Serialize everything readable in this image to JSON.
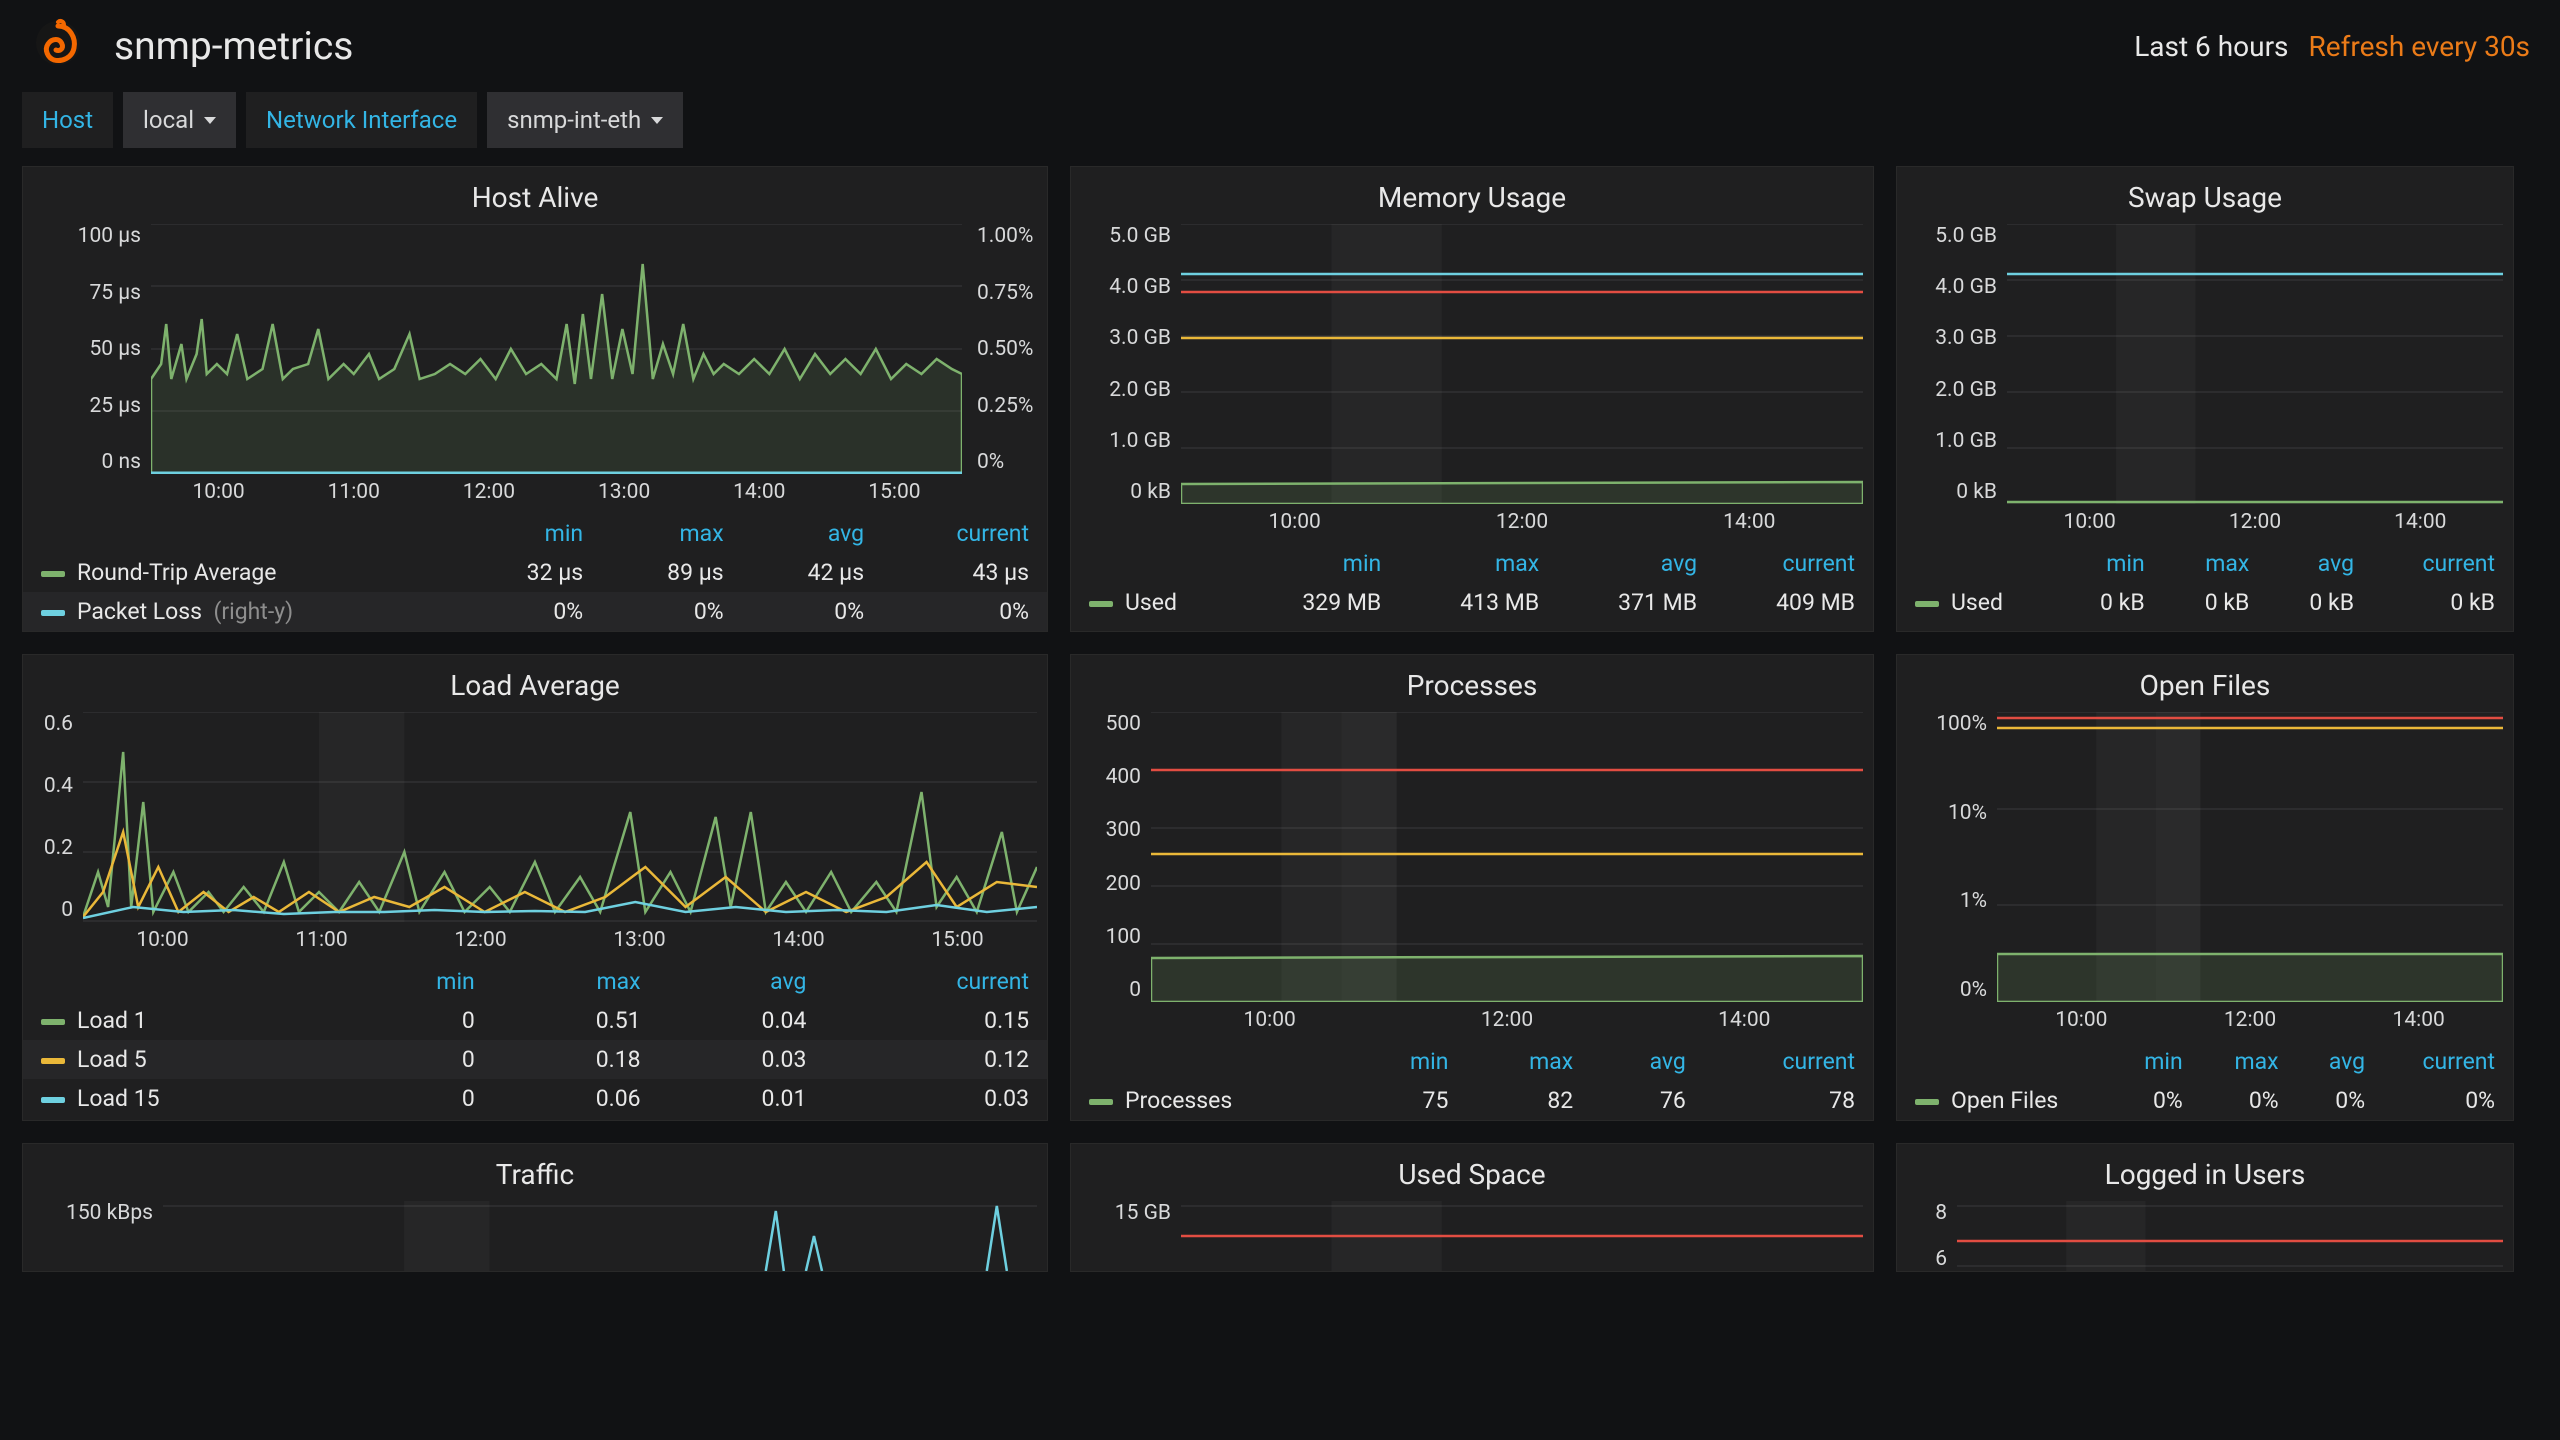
{
  "header": {
    "title": "snmp-metrics",
    "time_range": "Last 6 hours",
    "refresh": "Refresh every 30s"
  },
  "vars": {
    "host_label": "Host",
    "host_value": "local",
    "iface_label": "Network Interface",
    "iface_value": "snmp-int-eth"
  },
  "stat_headers": {
    "min": "min",
    "max": "max",
    "avg": "avg",
    "current": "current"
  },
  "panels": {
    "host_alive": {
      "title": "Host Alive",
      "y_left": [
        "100 µs",
        "75 µs",
        "50 µs",
        "25 µs",
        "0 ns"
      ],
      "y_right": [
        "1.00%",
        "0.75%",
        "0.50%",
        "0.25%",
        "0%"
      ],
      "x": [
        "10:00",
        "11:00",
        "12:00",
        "13:00",
        "14:00",
        "15:00"
      ],
      "series": [
        {
          "name": "Round-Trip Average",
          "color": "#7eb26d",
          "min": "32 µs",
          "max": "89 µs",
          "avg": "42 µs",
          "current": "43 µs"
        },
        {
          "name": "Packet Loss",
          "suffix": "(right-y)",
          "color": "#6ed0e0",
          "min": "0%",
          "max": "0%",
          "avg": "0%",
          "current": "0%"
        }
      ]
    },
    "memory": {
      "title": "Memory Usage",
      "y": [
        "5.0 GB",
        "4.0 GB",
        "3.0 GB",
        "2.0 GB",
        "1.0 GB",
        "0 kB"
      ],
      "x": [
        "10:00",
        "12:00",
        "14:00"
      ],
      "series": [
        {
          "name": "Used",
          "color": "#7eb26d",
          "min": "329 MB",
          "max": "413 MB",
          "avg": "371 MB",
          "current": "409 MB"
        }
      ]
    },
    "swap": {
      "title": "Swap Usage",
      "y": [
        "5.0 GB",
        "4.0 GB",
        "3.0 GB",
        "2.0 GB",
        "1.0 GB",
        "0 kB"
      ],
      "x": [
        "10:00",
        "12:00",
        "14:00"
      ],
      "series": [
        {
          "name": "Used",
          "color": "#7eb26d",
          "min": "0 kB",
          "max": "0 kB",
          "avg": "0 kB",
          "current": "0 kB"
        }
      ]
    },
    "load": {
      "title": "Load Average",
      "y": [
        "0.6",
        "0.4",
        "0.2",
        "0"
      ],
      "x": [
        "10:00",
        "11:00",
        "12:00",
        "13:00",
        "14:00",
        "15:00"
      ],
      "series": [
        {
          "name": "Load 1",
          "color": "#7eb26d",
          "min": "0",
          "max": "0.51",
          "avg": "0.04",
          "current": "0.15"
        },
        {
          "name": "Load 5",
          "color": "#eab839",
          "min": "0",
          "max": "0.18",
          "avg": "0.03",
          "current": "0.12"
        },
        {
          "name": "Load 15",
          "color": "#6ed0e0",
          "min": "0",
          "max": "0.06",
          "avg": "0.01",
          "current": "0.03"
        }
      ]
    },
    "processes": {
      "title": "Processes",
      "y": [
        "500",
        "400",
        "300",
        "200",
        "100",
        "0"
      ],
      "x": [
        "10:00",
        "12:00",
        "14:00"
      ],
      "series": [
        {
          "name": "Processes",
          "color": "#7eb26d",
          "min": "75",
          "max": "82",
          "avg": "76",
          "current": "78"
        }
      ]
    },
    "open_files": {
      "title": "Open Files",
      "y": [
        "100%",
        "10%",
        "1%",
        "0%"
      ],
      "x": [
        "10:00",
        "12:00",
        "14:00"
      ],
      "series": [
        {
          "name": "Open Files",
          "color": "#7eb26d",
          "min": "0%",
          "max": "0%",
          "avg": "0%",
          "current": "0%"
        }
      ]
    },
    "traffic": {
      "title": "Traffic",
      "y": [
        "150 kBps"
      ]
    },
    "used_space": {
      "title": "Used Space",
      "y": [
        "15 GB"
      ]
    },
    "logged_in": {
      "title": "Logged in Users",
      "y": [
        "8",
        "6"
      ]
    }
  },
  "chart_data": [
    {
      "panel": "host_alive",
      "type": "line",
      "title": "Host Alive",
      "xlabel": "time",
      "series": [
        {
          "name": "Round-Trip Average",
          "unit": "µs",
          "ylim": [
            0,
            100
          ],
          "approx_baseline": 40,
          "approx_peak": 89
        },
        {
          "name": "Packet Loss",
          "unit": "%",
          "ylim": [
            0,
            1
          ],
          "constant": 0
        }
      ],
      "x_range": [
        "09:30",
        "15:30"
      ]
    },
    {
      "panel": "memory",
      "type": "line",
      "title": "Memory Usage",
      "ylim": [
        0,
        5
      ],
      "yunit": "GB",
      "x_range": [
        "09:30",
        "15:30"
      ],
      "series": [
        {
          "name": "Used",
          "approx_constant_gb": 0.37
        },
        {
          "name": "threshold",
          "color": "#6ed0e0",
          "constant_gb": 4.1
        },
        {
          "name": "threshold",
          "color": "#e24d42",
          "constant_gb": 3.8
        },
        {
          "name": "threshold",
          "color": "#eab839",
          "constant_gb": 3.0
        }
      ]
    },
    {
      "panel": "swap",
      "type": "line",
      "title": "Swap Usage",
      "ylim": [
        0,
        5
      ],
      "yunit": "GB",
      "x_range": [
        "09:30",
        "15:30"
      ],
      "series": [
        {
          "name": "Used",
          "constant_gb": 0
        },
        {
          "name": "threshold",
          "color": "#6ed0e0",
          "constant_gb": 4.1
        }
      ]
    },
    {
      "panel": "load",
      "type": "line",
      "title": "Load Average",
      "ylim": [
        0,
        0.6
      ],
      "x_range": [
        "09:30",
        "15:30"
      ],
      "series": [
        {
          "name": "Load 1",
          "approx_mean": 0.04,
          "approx_peak": 0.51
        },
        {
          "name": "Load 5",
          "approx_mean": 0.03,
          "approx_peak": 0.18
        },
        {
          "name": "Load 15",
          "approx_mean": 0.01,
          "approx_peak": 0.06
        }
      ]
    },
    {
      "panel": "processes",
      "type": "line",
      "title": "Processes",
      "ylim": [
        0,
        500
      ],
      "x_range": [
        "09:30",
        "15:30"
      ],
      "series": [
        {
          "name": "Processes",
          "approx_constant": 76
        },
        {
          "name": "threshold",
          "color": "#e24d42",
          "constant": 400
        },
        {
          "name": "threshold",
          "color": "#eab839",
          "constant": 255
        }
      ]
    },
    {
      "panel": "open_files",
      "type": "line",
      "title": "Open Files",
      "yscale": "log",
      "ylim_pct": [
        0,
        100
      ],
      "x_range": [
        "09:30",
        "15:30"
      ],
      "series": [
        {
          "name": "Open Files",
          "approx_constant_pct": 0.3
        },
        {
          "name": "threshold",
          "color": "#e24d42",
          "constant_pct": 95
        },
        {
          "name": "threshold",
          "color": "#eab839",
          "constant_pct": 75
        }
      ]
    }
  ]
}
